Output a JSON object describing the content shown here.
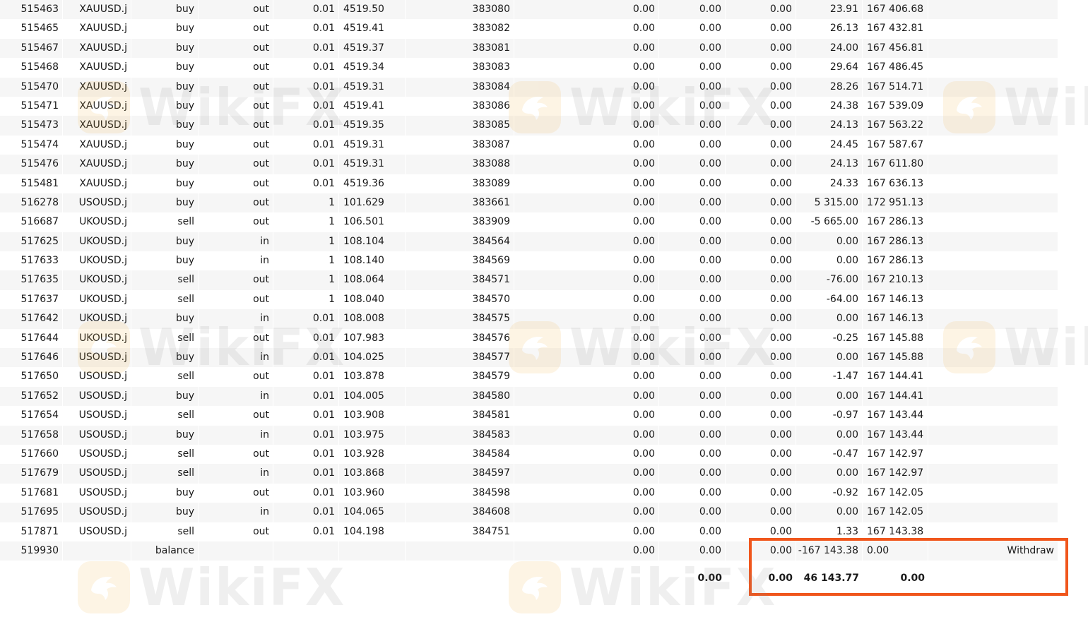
{
  "watermark": {
    "text": "WikiFX",
    "icon": "wikifx-eagle-icon"
  },
  "colors": {
    "highlight": "#f0561c",
    "stripe": "#f6f6f6"
  },
  "rows": [
    {
      "deal": "515463",
      "symbol": "XAUUSD.j",
      "type": "buy",
      "direction": "out",
      "volume": "0.01",
      "price": "4519.50",
      "order": "383080",
      "commission": "0.00",
      "fee": "0.00",
      "swap": "0.00",
      "profit": "23.91",
      "balance": "167 406.68",
      "comment": ""
    },
    {
      "deal": "515465",
      "symbol": "XAUUSD.j",
      "type": "buy",
      "direction": "out",
      "volume": "0.01",
      "price": "4519.41",
      "order": "383082",
      "commission": "0.00",
      "fee": "0.00",
      "swap": "0.00",
      "profit": "26.13",
      "balance": "167 432.81",
      "comment": ""
    },
    {
      "deal": "515467",
      "symbol": "XAUUSD.j",
      "type": "buy",
      "direction": "out",
      "volume": "0.01",
      "price": "4519.37",
      "order": "383081",
      "commission": "0.00",
      "fee": "0.00",
      "swap": "0.00",
      "profit": "24.00",
      "balance": "167 456.81",
      "comment": ""
    },
    {
      "deal": "515468",
      "symbol": "XAUUSD.j",
      "type": "buy",
      "direction": "out",
      "volume": "0.01",
      "price": "4519.34",
      "order": "383083",
      "commission": "0.00",
      "fee": "0.00",
      "swap": "0.00",
      "profit": "29.64",
      "balance": "167 486.45",
      "comment": ""
    },
    {
      "deal": "515470",
      "symbol": "XAUUSD.j",
      "type": "buy",
      "direction": "out",
      "volume": "0.01",
      "price": "4519.31",
      "order": "383084",
      "commission": "0.00",
      "fee": "0.00",
      "swap": "0.00",
      "profit": "28.26",
      "balance": "167 514.71",
      "comment": ""
    },
    {
      "deal": "515471",
      "symbol": "XAUUSD.j",
      "type": "buy",
      "direction": "out",
      "volume": "0.01",
      "price": "4519.41",
      "order": "383086",
      "commission": "0.00",
      "fee": "0.00",
      "swap": "0.00",
      "profit": "24.38",
      "balance": "167 539.09",
      "comment": ""
    },
    {
      "deal": "515473",
      "symbol": "XAUUSD.j",
      "type": "buy",
      "direction": "out",
      "volume": "0.01",
      "price": "4519.35",
      "order": "383085",
      "commission": "0.00",
      "fee": "0.00",
      "swap": "0.00",
      "profit": "24.13",
      "balance": "167 563.22",
      "comment": ""
    },
    {
      "deal": "515474",
      "symbol": "XAUUSD.j",
      "type": "buy",
      "direction": "out",
      "volume": "0.01",
      "price": "4519.31",
      "order": "383087",
      "commission": "0.00",
      "fee": "0.00",
      "swap": "0.00",
      "profit": "24.45",
      "balance": "167 587.67",
      "comment": ""
    },
    {
      "deal": "515476",
      "symbol": "XAUUSD.j",
      "type": "buy",
      "direction": "out",
      "volume": "0.01",
      "price": "4519.31",
      "order": "383088",
      "commission": "0.00",
      "fee": "0.00",
      "swap": "0.00",
      "profit": "24.13",
      "balance": "167 611.80",
      "comment": ""
    },
    {
      "deal": "515481",
      "symbol": "XAUUSD.j",
      "type": "buy",
      "direction": "out",
      "volume": "0.01",
      "price": "4519.36",
      "order": "383089",
      "commission": "0.00",
      "fee": "0.00",
      "swap": "0.00",
      "profit": "24.33",
      "balance": "167 636.13",
      "comment": ""
    },
    {
      "deal": "516278",
      "symbol": "USOUSD.j",
      "type": "buy",
      "direction": "out",
      "volume": "1",
      "price": "101.629",
      "order": "383661",
      "commission": "0.00",
      "fee": "0.00",
      "swap": "0.00",
      "profit": "5 315.00",
      "balance": "172 951.13",
      "comment": ""
    },
    {
      "deal": "516687",
      "symbol": "UKOUSD.j",
      "type": "sell",
      "direction": "out",
      "volume": "1",
      "price": "106.501",
      "order": "383909",
      "commission": "0.00",
      "fee": "0.00",
      "swap": "0.00",
      "profit": "-5 665.00",
      "balance": "167 286.13",
      "comment": ""
    },
    {
      "deal": "517625",
      "symbol": "UKOUSD.j",
      "type": "buy",
      "direction": "in",
      "volume": "1",
      "price": "108.104",
      "order": "384564",
      "commission": "0.00",
      "fee": "0.00",
      "swap": "0.00",
      "profit": "0.00",
      "balance": "167 286.13",
      "comment": ""
    },
    {
      "deal": "517633",
      "symbol": "UKOUSD.j",
      "type": "buy",
      "direction": "in",
      "volume": "1",
      "price": "108.140",
      "order": "384569",
      "commission": "0.00",
      "fee": "0.00",
      "swap": "0.00",
      "profit": "0.00",
      "balance": "167 286.13",
      "comment": ""
    },
    {
      "deal": "517635",
      "symbol": "UKOUSD.j",
      "type": "sell",
      "direction": "out",
      "volume": "1",
      "price": "108.064",
      "order": "384571",
      "commission": "0.00",
      "fee": "0.00",
      "swap": "0.00",
      "profit": "-76.00",
      "balance": "167 210.13",
      "comment": ""
    },
    {
      "deal": "517637",
      "symbol": "UKOUSD.j",
      "type": "sell",
      "direction": "out",
      "volume": "1",
      "price": "108.040",
      "order": "384570",
      "commission": "0.00",
      "fee": "0.00",
      "swap": "0.00",
      "profit": "-64.00",
      "balance": "167 146.13",
      "comment": ""
    },
    {
      "deal": "517642",
      "symbol": "UKOUSD.j",
      "type": "buy",
      "direction": "in",
      "volume": "0.01",
      "price": "108.008",
      "order": "384575",
      "commission": "0.00",
      "fee": "0.00",
      "swap": "0.00",
      "profit": "0.00",
      "balance": "167 146.13",
      "comment": ""
    },
    {
      "deal": "517644",
      "symbol": "UKOUSD.j",
      "type": "sell",
      "direction": "out",
      "volume": "0.01",
      "price": "107.983",
      "order": "384576",
      "commission": "0.00",
      "fee": "0.00",
      "swap": "0.00",
      "profit": "-0.25",
      "balance": "167 145.88",
      "comment": ""
    },
    {
      "deal": "517646",
      "symbol": "USOUSD.j",
      "type": "buy",
      "direction": "in",
      "volume": "0.01",
      "price": "104.025",
      "order": "384577",
      "commission": "0.00",
      "fee": "0.00",
      "swap": "0.00",
      "profit": "0.00",
      "balance": "167 145.88",
      "comment": ""
    },
    {
      "deal": "517650",
      "symbol": "USOUSD.j",
      "type": "sell",
      "direction": "out",
      "volume": "0.01",
      "price": "103.878",
      "order": "384579",
      "commission": "0.00",
      "fee": "0.00",
      "swap": "0.00",
      "profit": "-1.47",
      "balance": "167 144.41",
      "comment": ""
    },
    {
      "deal": "517652",
      "symbol": "USOUSD.j",
      "type": "buy",
      "direction": "in",
      "volume": "0.01",
      "price": "104.005",
      "order": "384580",
      "commission": "0.00",
      "fee": "0.00",
      "swap": "0.00",
      "profit": "0.00",
      "balance": "167 144.41",
      "comment": ""
    },
    {
      "deal": "517654",
      "symbol": "USOUSD.j",
      "type": "sell",
      "direction": "out",
      "volume": "0.01",
      "price": "103.908",
      "order": "384581",
      "commission": "0.00",
      "fee": "0.00",
      "swap": "0.00",
      "profit": "-0.97",
      "balance": "167 143.44",
      "comment": ""
    },
    {
      "deal": "517658",
      "symbol": "USOUSD.j",
      "type": "buy",
      "direction": "in",
      "volume": "0.01",
      "price": "103.975",
      "order": "384583",
      "commission": "0.00",
      "fee": "0.00",
      "swap": "0.00",
      "profit": "0.00",
      "balance": "167 143.44",
      "comment": ""
    },
    {
      "deal": "517660",
      "symbol": "USOUSD.j",
      "type": "sell",
      "direction": "out",
      "volume": "0.01",
      "price": "103.928",
      "order": "384584",
      "commission": "0.00",
      "fee": "0.00",
      "swap": "0.00",
      "profit": "-0.47",
      "balance": "167 142.97",
      "comment": ""
    },
    {
      "deal": "517679",
      "symbol": "USOUSD.j",
      "type": "sell",
      "direction": "in",
      "volume": "0.01",
      "price": "103.868",
      "order": "384597",
      "commission": "0.00",
      "fee": "0.00",
      "swap": "0.00",
      "profit": "0.00",
      "balance": "167 142.97",
      "comment": ""
    },
    {
      "deal": "517681",
      "symbol": "USOUSD.j",
      "type": "buy",
      "direction": "out",
      "volume": "0.01",
      "price": "103.960",
      "order": "384598",
      "commission": "0.00",
      "fee": "0.00",
      "swap": "0.00",
      "profit": "-0.92",
      "balance": "167 142.05",
      "comment": ""
    },
    {
      "deal": "517695",
      "symbol": "USOUSD.j",
      "type": "buy",
      "direction": "in",
      "volume": "0.01",
      "price": "104.065",
      "order": "384608",
      "commission": "0.00",
      "fee": "0.00",
      "swap": "0.00",
      "profit": "0.00",
      "balance": "167 142.05",
      "comment": ""
    },
    {
      "deal": "517871",
      "symbol": "USOUSD.j",
      "type": "sell",
      "direction": "out",
      "volume": "0.01",
      "price": "104.198",
      "order": "384751",
      "commission": "0.00",
      "fee": "0.00",
      "swap": "0.00",
      "profit": "1.33",
      "balance": "167 143.38",
      "comment": ""
    },
    {
      "deal": "519930",
      "symbol": "",
      "type": "balance",
      "direction": "",
      "volume": "",
      "price": "",
      "order": "",
      "commission": "0.00",
      "fee": "0.00",
      "swap": "0.00",
      "profit": "-167 143.38",
      "balance": "0.00",
      "comment": "Withdraw"
    }
  ],
  "totals": {
    "fee": "0.00",
    "swap": "0.00",
    "profit": "46 143.77",
    "balance": "0.00"
  }
}
